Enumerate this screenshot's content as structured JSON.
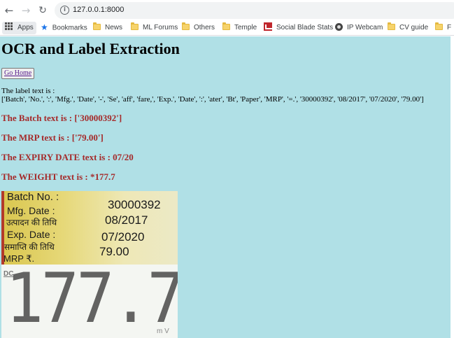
{
  "browser": {
    "url": "127.0.0.1:8000",
    "back_glyph": "←",
    "forward_glyph": "→",
    "reload_glyph": "↻",
    "info_glyph": "i"
  },
  "bookmarks": [
    {
      "label": "Apps",
      "icon": "apps-grid-icon"
    },
    {
      "label": "Bookmarks",
      "icon": "star-icon"
    },
    {
      "label": "News",
      "icon": "folder-icon"
    },
    {
      "label": "ML Forums",
      "icon": "folder-icon"
    },
    {
      "label": "Others",
      "icon": "folder-icon"
    },
    {
      "label": "Temple",
      "icon": "folder-icon"
    },
    {
      "label": "Social Blade Stats",
      "icon": "social-blade-icon"
    },
    {
      "label": "IP Webcam",
      "icon": "webcam-icon"
    },
    {
      "label": "CV guide",
      "icon": "folder-icon"
    },
    {
      "label": "F",
      "icon": "folder-icon"
    }
  ],
  "page": {
    "title": "OCR and Label Extraction",
    "home_button": "Go Home",
    "label_heading": "The label text is :",
    "label_list": "['Batch', 'No.', ':', 'Mfg.', 'Date', '-', 'Se', 'aff', 'fare,', 'Exp.', 'Date', ':', 'ater', 'Bt', 'Paper', 'MRP', '=.', '30000392', '08/2017', '07/2020', '79.00']",
    "batch_result": "The Batch text is : ['30000392']",
    "mrp_result": "The MRP text is : ['79.00']",
    "expiry_result": "The EXPIRY DATE text is : 07/20",
    "weight_result": "The WEIGHT text is : *177.7",
    "background_color": "#b0e0e6",
    "result_color": "#a52a2a"
  },
  "label_photo": {
    "rows": [
      {
        "left": "Batch No. :",
        "right": "30000392"
      },
      {
        "left": "Mfg. Date :",
        "right": ""
      },
      {
        "left": "उत्पादन की तिथि",
        "right": "08/2017"
      },
      {
        "left": "Exp. Date :",
        "right": "07/2020"
      },
      {
        "left": "समाप्ति की तिथि",
        "right": "79.00"
      },
      {
        "left": "MRP ₹.",
        "right": ""
      }
    ]
  },
  "scale_photo": {
    "dc_label": "DC",
    "digits": "177.7",
    "unit": "m V"
  }
}
